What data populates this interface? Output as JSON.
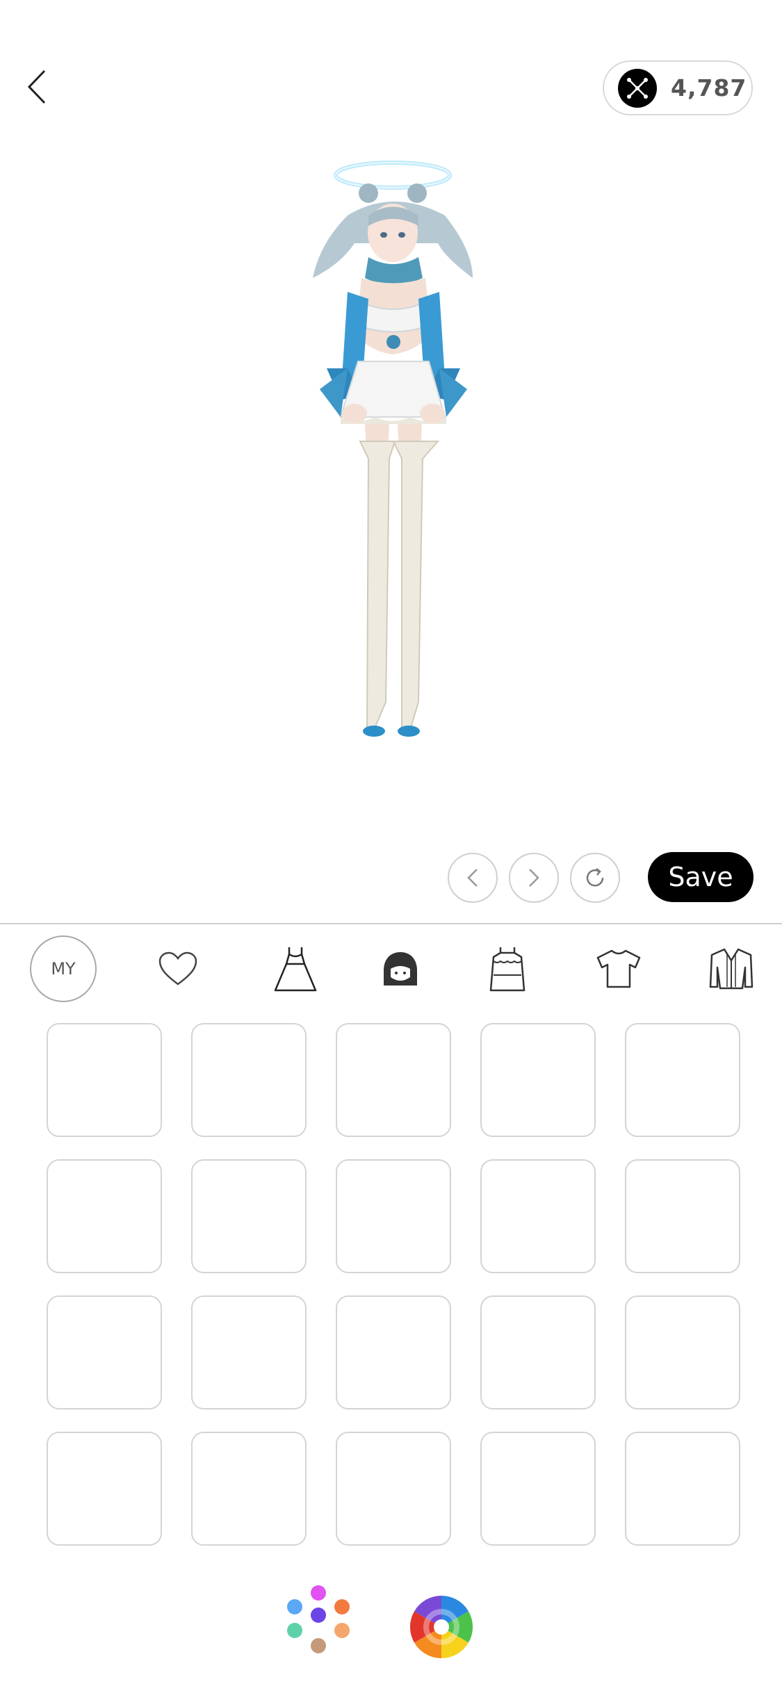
{
  "header": {
    "back_icon": "chevron-left-icon",
    "coin_icon": "network-icon",
    "coin_balance": "4,787"
  },
  "controls": {
    "undo_icon": "chevron-left-icon",
    "redo_icon": "chevron-right-icon",
    "reset_icon": "refresh-icon",
    "save_label": "Save"
  },
  "categories": [
    {
      "name": "my",
      "label": "MY"
    },
    {
      "name": "favorites",
      "icon": "heart-icon"
    },
    {
      "name": "dress",
      "icon": "dress-icon"
    },
    {
      "name": "hair",
      "icon": "hair-icon"
    },
    {
      "name": "costume",
      "icon": "frilled-dress-icon"
    },
    {
      "name": "top",
      "icon": "tshirt-icon"
    },
    {
      "name": "outerwear",
      "icon": "jacket-icon"
    }
  ],
  "grid_slot_count": 20,
  "bottom": {
    "palette_icon": "color-dots-icon",
    "wheel_icon": "color-wheel-icon"
  },
  "colors": {
    "palette_dots": [
      "#e251f2",
      "#5aa8f6",
      "#6c45e8",
      "#f37a3e",
      "#5fd1a8",
      "#c49a7a",
      "#f5a66d"
    ],
    "wheel": [
      "#e2352b",
      "#f58a1f",
      "#f7d21c",
      "#4cc24a",
      "#2a88e0",
      "#7a4ad6"
    ]
  }
}
